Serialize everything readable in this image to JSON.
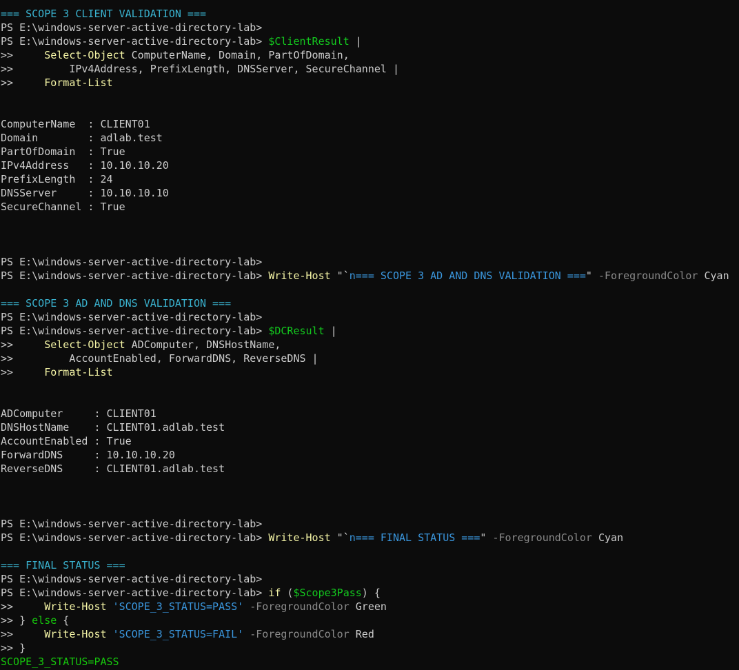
{
  "colors": {
    "background": "#0c0c0c",
    "default": "#cccccc",
    "cyan": "#3ab3d0",
    "yellow": "#f5f5a6",
    "green": "#16c60c",
    "white": "#f2f2f2",
    "gray": "#8a8a8a",
    "string": "#3a96dd",
    "var": "#13c91e",
    "kw": "#16c60c"
  },
  "lines": [
    [
      {
        "t": "=== SCOPE 3 CLIENT VALIDATION ===",
        "c": "cyan"
      }
    ],
    [
      {
        "t": "PS E:\\windows-server-active-directory-lab>",
        "c": "default"
      }
    ],
    [
      {
        "t": "PS E:\\windows-server-active-directory-lab> ",
        "c": "default"
      },
      {
        "t": "$ClientResult",
        "c": "var"
      },
      {
        "t": " |",
        "c": "default"
      }
    ],
    [
      {
        "t": ">>     ",
        "c": "default"
      },
      {
        "t": "Select-Object",
        "c": "yellow"
      },
      {
        "t": " ComputerName, Domain, PartOfDomain,",
        "c": "default"
      }
    ],
    [
      {
        "t": ">>         IPv4Address, PrefixLength, DNSServer, SecureChannel |",
        "c": "default"
      }
    ],
    [
      {
        "t": ">>     ",
        "c": "default"
      },
      {
        "t": "Format-List",
        "c": "yellow"
      }
    ],
    [],
    [],
    [
      {
        "t": "ComputerName  : CLIENT01",
        "c": "default"
      }
    ],
    [
      {
        "t": "Domain        : adlab.test",
        "c": "default"
      }
    ],
    [
      {
        "t": "PartOfDomain  : True",
        "c": "default"
      }
    ],
    [
      {
        "t": "IPv4Address   : 10.10.10.20",
        "c": "default"
      }
    ],
    [
      {
        "t": "PrefixLength  : 24",
        "c": "default"
      }
    ],
    [
      {
        "t": "DNSServer     : 10.10.10.10",
        "c": "default"
      }
    ],
    [
      {
        "t": "SecureChannel : True",
        "c": "default"
      }
    ],
    [],
    [],
    [],
    [
      {
        "t": "PS E:\\windows-server-active-directory-lab>",
        "c": "default"
      }
    ],
    [
      {
        "t": "PS E:\\windows-server-active-directory-lab> ",
        "c": "default"
      },
      {
        "t": "Write-Host",
        "c": "yellow"
      },
      {
        "t": " \"",
        "c": "default"
      },
      {
        "t": "`",
        "c": "white"
      },
      {
        "t": "n=== SCOPE 3 AD AND DNS VALIDATION ===",
        "c": "string"
      },
      {
        "t": "\"",
        "c": "default"
      },
      {
        "t": " -ForegroundColor",
        "c": "gray"
      },
      {
        "t": " Cyan",
        "c": "default"
      }
    ],
    [],
    [
      {
        "t": "=== SCOPE 3 AD AND DNS VALIDATION ===",
        "c": "cyan"
      }
    ],
    [
      {
        "t": "PS E:\\windows-server-active-directory-lab>",
        "c": "default"
      }
    ],
    [
      {
        "t": "PS E:\\windows-server-active-directory-lab> ",
        "c": "default"
      },
      {
        "t": "$DCResult",
        "c": "var"
      },
      {
        "t": " |",
        "c": "default"
      }
    ],
    [
      {
        "t": ">>     ",
        "c": "default"
      },
      {
        "t": "Select-Object",
        "c": "yellow"
      },
      {
        "t": " ADComputer, DNSHostName,",
        "c": "default"
      }
    ],
    [
      {
        "t": ">>         AccountEnabled, ForwardDNS, ReverseDNS |",
        "c": "default"
      }
    ],
    [
      {
        "t": ">>     ",
        "c": "default"
      },
      {
        "t": "Format-List",
        "c": "yellow"
      }
    ],
    [],
    [],
    [
      {
        "t": "ADComputer     : CLIENT01",
        "c": "default"
      }
    ],
    [
      {
        "t": "DNSHostName    : CLIENT01.adlab.test",
        "c": "default"
      }
    ],
    [
      {
        "t": "AccountEnabled : True",
        "c": "default"
      }
    ],
    [
      {
        "t": "ForwardDNS     : 10.10.10.20",
        "c": "default"
      }
    ],
    [
      {
        "t": "ReverseDNS     : CLIENT01.adlab.test",
        "c": "default"
      }
    ],
    [],
    [],
    [],
    [
      {
        "t": "PS E:\\windows-server-active-directory-lab>",
        "c": "default"
      }
    ],
    [
      {
        "t": "PS E:\\windows-server-active-directory-lab> ",
        "c": "default"
      },
      {
        "t": "Write-Host",
        "c": "yellow"
      },
      {
        "t": " \"",
        "c": "default"
      },
      {
        "t": "`",
        "c": "white"
      },
      {
        "t": "n=== FINAL STATUS ===",
        "c": "string"
      },
      {
        "t": "\"",
        "c": "default"
      },
      {
        "t": " -ForegroundColor",
        "c": "gray"
      },
      {
        "t": " Cyan",
        "c": "default"
      }
    ],
    [],
    [
      {
        "t": "=== FINAL STATUS ===",
        "c": "cyan"
      }
    ],
    [
      {
        "t": "PS E:\\windows-server-active-directory-lab>",
        "c": "default"
      }
    ],
    [
      {
        "t": "PS E:\\windows-server-active-directory-lab> ",
        "c": "default"
      },
      {
        "t": "if",
        "c": "yellow"
      },
      {
        "t": " (",
        "c": "default"
      },
      {
        "t": "$Scope3Pass",
        "c": "var"
      },
      {
        "t": ") {",
        "c": "default"
      }
    ],
    [
      {
        "t": ">>     ",
        "c": "default"
      },
      {
        "t": "Write-Host",
        "c": "yellow"
      },
      {
        "t": " 'SCOPE_3_STATUS=PASS'",
        "c": "string"
      },
      {
        "t": " -ForegroundColor",
        "c": "gray"
      },
      {
        "t": " Green",
        "c": "default"
      }
    ],
    [
      {
        "t": ">> } ",
        "c": "default"
      },
      {
        "t": "else",
        "c": "kw"
      },
      {
        "t": " {",
        "c": "default"
      }
    ],
    [
      {
        "t": ">>     ",
        "c": "default"
      },
      {
        "t": "Write-Host",
        "c": "yellow"
      },
      {
        "t": " 'SCOPE_3_STATUS=FAIL'",
        "c": "string"
      },
      {
        "t": " -ForegroundColor",
        "c": "gray"
      },
      {
        "t": " Red",
        "c": "default"
      }
    ],
    [
      {
        "t": ">> }",
        "c": "default"
      }
    ],
    [
      {
        "t": "SCOPE_3_STATUS=PASS",
        "c": "green"
      }
    ]
  ]
}
